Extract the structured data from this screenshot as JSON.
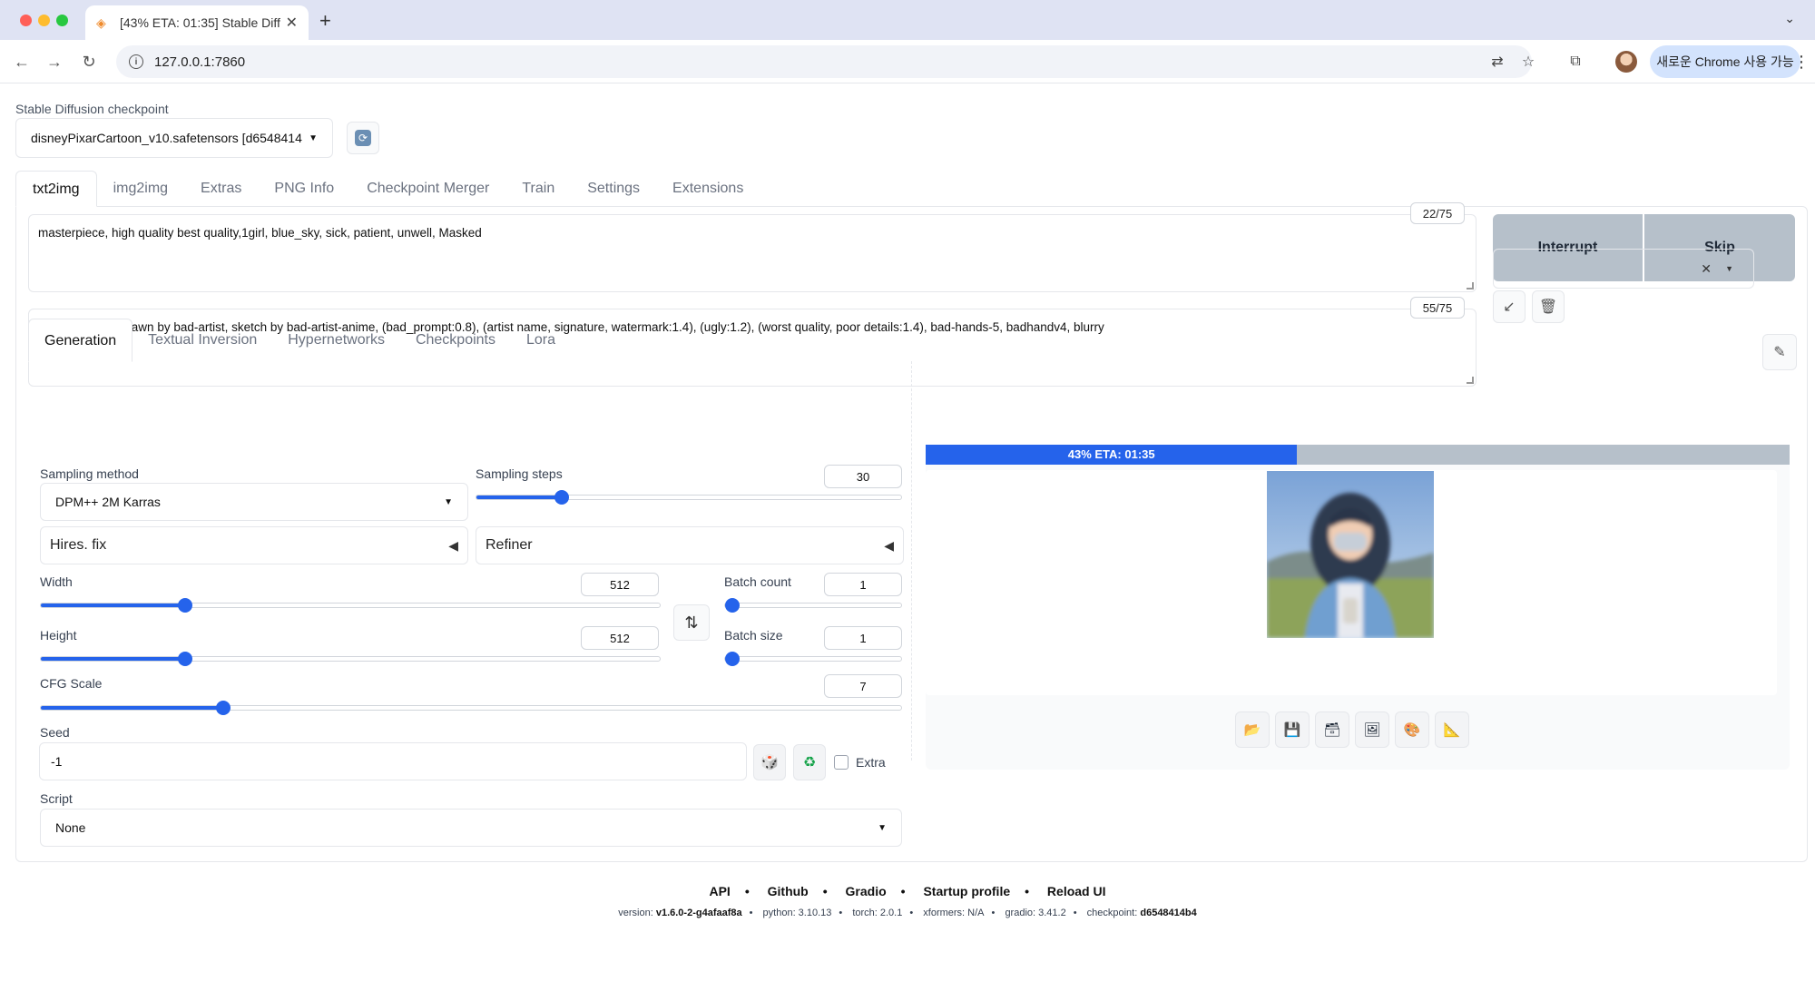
{
  "browser": {
    "tab_title": "[43% ETA: 01:35] Stable Diffusion",
    "url": "127.0.0.1:7860",
    "profile_button": "새로운 Chrome 사용 가능"
  },
  "checkpoint": {
    "label": "Stable Diffusion checkpoint",
    "value": "disneyPixarCartoon_v10.safetensors [d6548414"
  },
  "main_tabs": [
    "txt2img",
    "img2img",
    "Extras",
    "PNG Info",
    "Checkpoint Merger",
    "Train",
    "Settings",
    "Extensions"
  ],
  "prompt": {
    "text": "masterpiece, high quality best quality,1girl, blue_sky, sick, patient, unwell, Masked",
    "token_count": "22/75"
  },
  "negative_prompt": {
    "text": "EasyNegative, drawn by bad-artist, sketch by bad-artist-anime, (bad_prompt:0.8), (artist name, signature, watermark:1.4), (ugly:1.2), (worst quality, poor details:1.4), bad-hands-5, badhandv4, blurry",
    "token_count": "55/75"
  },
  "actions": {
    "interrupt": "Interrupt",
    "skip": "Skip"
  },
  "sub_tabs": [
    "Generation",
    "Textual Inversion",
    "Hypernetworks",
    "Checkpoints",
    "Lora"
  ],
  "generation": {
    "sampling_method_label": "Sampling method",
    "sampling_method": "DPM++ 2M Karras",
    "sampling_steps_label": "Sampling steps",
    "sampling_steps": "30",
    "sampling_steps_fraction": 0.2,
    "hires_fix": "Hires. fix",
    "refiner": "Refiner",
    "width_label": "Width",
    "width": "512",
    "width_fraction": 0.233,
    "height_label": "Height",
    "height": "512",
    "height_fraction": 0.233,
    "batch_count_label": "Batch count",
    "batch_count": "1",
    "batch_size_label": "Batch size",
    "batch_size": "1",
    "cfg_label": "CFG Scale",
    "cfg": "7",
    "cfg_fraction": 0.212,
    "seed_label": "Seed",
    "seed": "-1",
    "extra_label": "Extra",
    "script_label": "Script",
    "script": "None"
  },
  "progress": {
    "text": "43% ETA: 01:35",
    "fraction": 0.43
  },
  "footer": {
    "links": [
      "API",
      "Github",
      "Gradio",
      "Startup profile",
      "Reload UI"
    ],
    "version_label": "version:",
    "version": "v1.6.0-2-g4afaaf8a",
    "python": "python: 3.10.13",
    "torch": "torch: 2.0.1",
    "xformers": "xformers: N/A",
    "gradio": "gradio: 3.41.2",
    "checkpoint_label": "checkpoint:",
    "checkpoint": "d6548414b4"
  },
  "colors": {
    "accent": "#2563eb",
    "button_gray": "#b6c0ca"
  }
}
